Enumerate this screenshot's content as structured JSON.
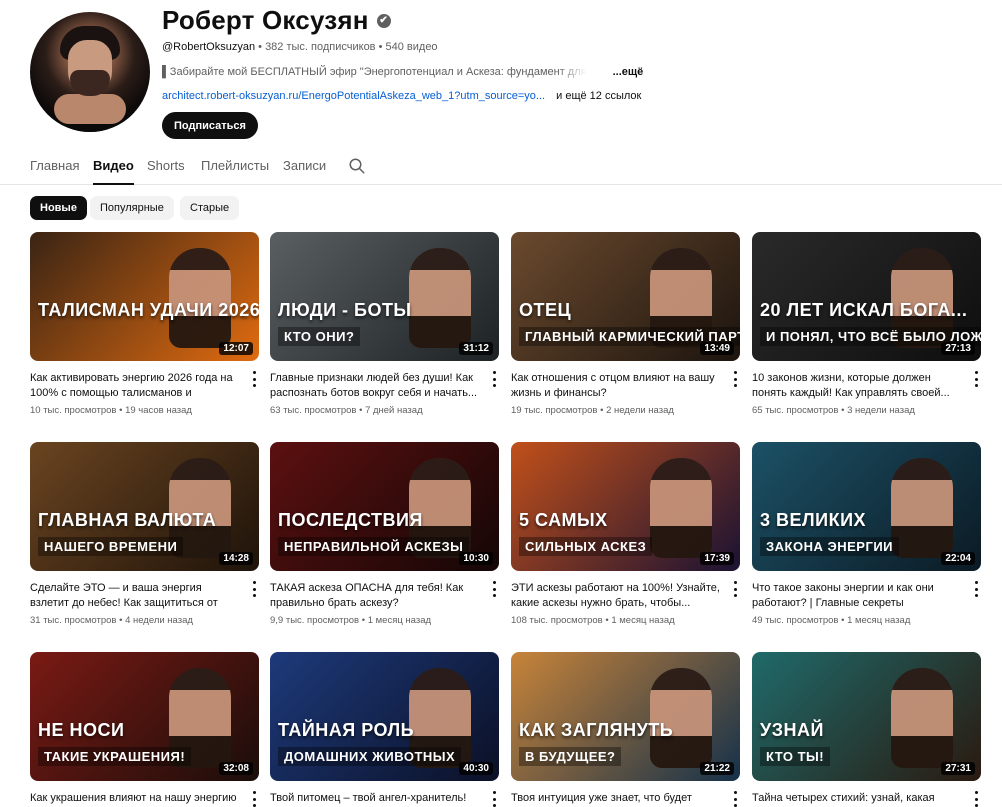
{
  "channel": {
    "name": "Роберт Оксузян",
    "verified_mark": "✔",
    "handle": "@RobertOksuzyan",
    "subscribers": "382 тыс. подписчиков",
    "videos_count": "540 видео",
    "separator": " • ",
    "description": "▌Забирайте мой БЕСПЛАТНЫЙ эфир \"Энергопотенциал и Аскеза: фундамент для",
    "more_label": "...ещё",
    "link": "architect.robert-oksuzyan.ru/EnergoPotentialAskeza_web_1?utm_source=yo...",
    "more_links": "и ещё 12 ссылок",
    "subscribe_label": "Подписаться"
  },
  "tabs": [
    "Главная",
    "Видео",
    "Shorts",
    "Плейлисты",
    "Записи"
  ],
  "active_tab": "Видео",
  "filters": [
    "Новые",
    "Популярные",
    "Старые"
  ],
  "active_filter": "Новые",
  "videos": [
    {
      "thumb_text1": "ТАЛИСМАН УДАЧИ 2026",
      "thumb_text2": "",
      "colors": [
        "#3a2414",
        "#e06b10"
      ],
      "duration": "12:07",
      "title": "Как активировать энергию 2026 года на 100% с помощью талисманов и застави...",
      "views": "10 тыс. просмотров",
      "age": "19 часов назад"
    },
    {
      "thumb_text1": "ЛЮДИ - БОТЫ",
      "thumb_text2": "КТО ОНИ?",
      "colors": [
        "#5a5f62",
        "#1d2225"
      ],
      "duration": "31:12",
      "title": "Главные признаки людей без души! Как распознать ботов вокруг себя и начать...",
      "views": "63 тыс. просмотров",
      "age": "7 дней назад"
    },
    {
      "thumb_text1": "ОТЕЦ",
      "thumb_text2": "ГЛАВНЫЙ КАРМИЧЕСКИЙ ПАРТНЕР",
      "colors": [
        "#6b4a2e",
        "#1c140e"
      ],
      "duration": "13:49",
      "title": "Как отношения с отцом влияют на вашу жизнь и финансы?",
      "views": "19 тыс. просмотров",
      "age": "2 недели назад"
    },
    {
      "thumb_text1": "20 ЛЕТ ИСКАЛ БОГА...",
      "thumb_text2": "И ПОНЯЛ, ЧТО ВСЁ БЫЛО ЛОЖЬЮ",
      "colors": [
        "#2a2a2a",
        "#0e0e0e"
      ],
      "duration": "27:13",
      "title": "10 законов жизни, которые должен понять каждый! Как управлять своей...",
      "views": "65 тыс. просмотров",
      "age": "3 недели назад"
    },
    {
      "thumb_text1": "ГЛАВНАЯ ВАЛЮТА",
      "thumb_text2": "НАШЕГО ВРЕМЕНИ",
      "colors": [
        "#6a4420",
        "#1e130a"
      ],
      "duration": "14:28",
      "title": "Сделайте ЭТО — и ваша энергия взлетит до небес! Как защититься от негатива и...",
      "views": "31 тыс. просмотров",
      "age": "4 недели назад"
    },
    {
      "thumb_text1": "ПОСЛЕДСТВИЯ",
      "thumb_text2": "НЕПРАВИЛЬНОЙ АСКЕЗЫ",
      "colors": [
        "#5c1010",
        "#140606"
      ],
      "duration": "10:30",
      "title": "ТАКАЯ аскеза ОПАСНА для тебя! Как правильно брать аскезу?",
      "views": "9,9 тыс. просмотров",
      "age": "1 месяц назад"
    },
    {
      "thumb_text1": "5 САМЫХ",
      "thumb_text2": "СИЛЬНЫХ АСКЕЗ",
      "colors": [
        "#c1501a",
        "#1a1233"
      ],
      "duration": "17:39",
      "title": "ЭТИ аскезы работают на 100%! Узнайте, какие аскезы нужно брать, чтобы...",
      "views": "108 тыс. просмотров",
      "age": "1 месяц назад"
    },
    {
      "thumb_text1": "3 ВЕЛИКИХ",
      "thumb_text2": "ЗАКОНА ЭНЕРГИИ",
      "colors": [
        "#1c5166",
        "#0b1a24"
      ],
      "duration": "22:04",
      "title": "Что такое законы энергии и как они работают? | Главные секреты управлени...",
      "views": "49 тыс. просмотров",
      "age": "1 месяц назад"
    },
    {
      "thumb_text1": "НЕ НОСИ",
      "thumb_text2": "ТАКИЕ УКРАШЕНИЯ!",
      "colors": [
        "#7a1a14",
        "#1a0d0a"
      ],
      "duration": "32:08",
      "title": "Как украшения влияют на нашу энергию",
      "views": "",
      "age": ""
    },
    {
      "thumb_text1": "ТАЙНАЯ РОЛЬ",
      "thumb_text2": "ДОМАШНИХ ЖИВОТНЫХ",
      "colors": [
        "#1d3a7a",
        "#0b1026"
      ],
      "duration": "40:30",
      "title": "Твой питомец – твой ангел-хранитель!",
      "views": "",
      "age": ""
    },
    {
      "thumb_text1": "КАК ЗАГЛЯНУТЬ",
      "thumb_text2": "В БУДУЩЕЕ?",
      "colors": [
        "#c8843a",
        "#15314a"
      ],
      "duration": "21:22",
      "title": "Твоя интуиция уже знает, что будет",
      "views": "",
      "age": ""
    },
    {
      "thumb_text1": "УЗНАЙ",
      "thumb_text2": "КТО ТЫ!",
      "colors": [
        "#1f6a6a",
        "#2a1a10"
      ],
      "duration": "27:31",
      "title": "Тайна четырех стихий: узнай, какая",
      "views": "",
      "age": ""
    }
  ]
}
